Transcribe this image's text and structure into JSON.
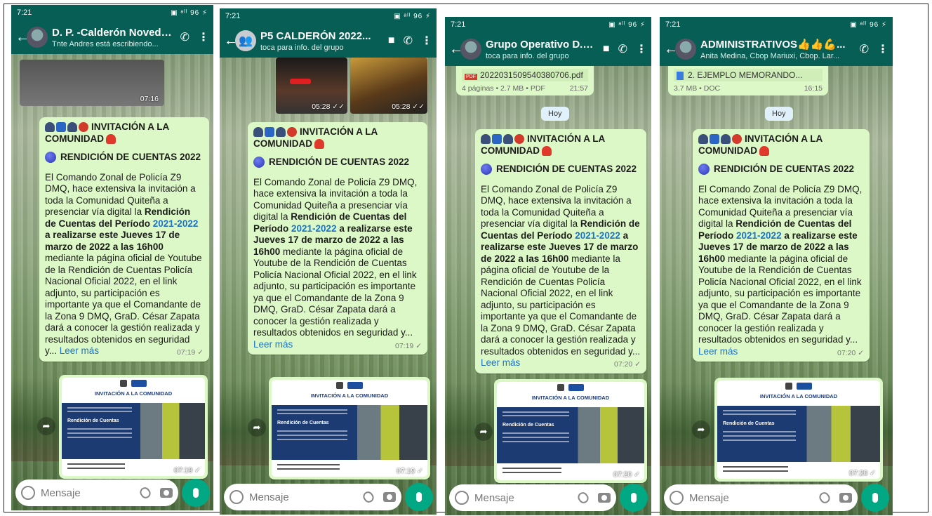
{
  "status_time": "7:21",
  "status_right": "▣ ᵃˡˡ 96 ⚡",
  "phones": [
    {
      "name": "D. P. -Calderón Novedades",
      "subtitle": "Tnte Andres está escribiendo...",
      "top_media_time": "07:16",
      "text_time": "07:19 ✓",
      "card_time": "07:19 ✓"
    },
    {
      "name": "P5 CALDERÓN 2022...",
      "subtitle": "toca para info. del grupo",
      "photo_time_1": "05:28 ✓✓",
      "photo_time_2": "05:28 ✓✓",
      "text_time": "07:19 ✓",
      "card_time": "07:19 ✓"
    },
    {
      "name": "Grupo Operativo D. C...",
      "subtitle": "toca para info. del grupo",
      "doc_name": "20220315095403807​06.pdf",
      "doc_meta": "4 páginas • 2.7 MB • PDF",
      "doc_time": "21:57",
      "day_label": "Hoy",
      "text_time": "07:20 ✓",
      "card_time": "07:20 ✓"
    },
    {
      "name": "ADMINISTRATIVOS👍👍💪...",
      "subtitle": "Anita Medina, Cbop Mariuxi, Cbop. Lar...",
      "doc_name": "2. EJEMPLO MEMORANDO...",
      "doc_meta": "3.7 MB • DOC",
      "doc_time": "16:15",
      "day_label": "Hoy",
      "text_time": "07:20 ✓",
      "card_time": "07:20 ✓"
    }
  ],
  "message": {
    "header_line1": "INVITACIÓN A LA",
    "header_line2": "COMUNIDAD",
    "rendicion": "RENDICIÓN DE CUENTAS 2022",
    "p1": "El Comando Zonal de Policía Z9 DMQ, hace extensiva la invitación a toda la Comunidad Quiteña a presenciar vía digital la ",
    "bold1": "Rendición de Cuentas del Período ",
    "link_years": "2021-2022",
    "bold2": " a realizarse este Jueves 17 de marzo de 2022 a las 16h00",
    "p2": " mediante la página oficial de Youtube de la Rendición de Cuentas Policía Nacional Oficial 2022, en el link adjunto, su participación es importante ya que el Comandante de la Zona 9 DMQ, GraD. César Zapata dará a conocer la gestión realizada y resultados obtenidos en seguridad y... ",
    "read_more": "Leer más"
  },
  "card": {
    "title": "INVITACIÓN A LA COMUNIDAD",
    "heading": "Rendición de Cuentas"
  },
  "input_placeholder": "Mensaje"
}
